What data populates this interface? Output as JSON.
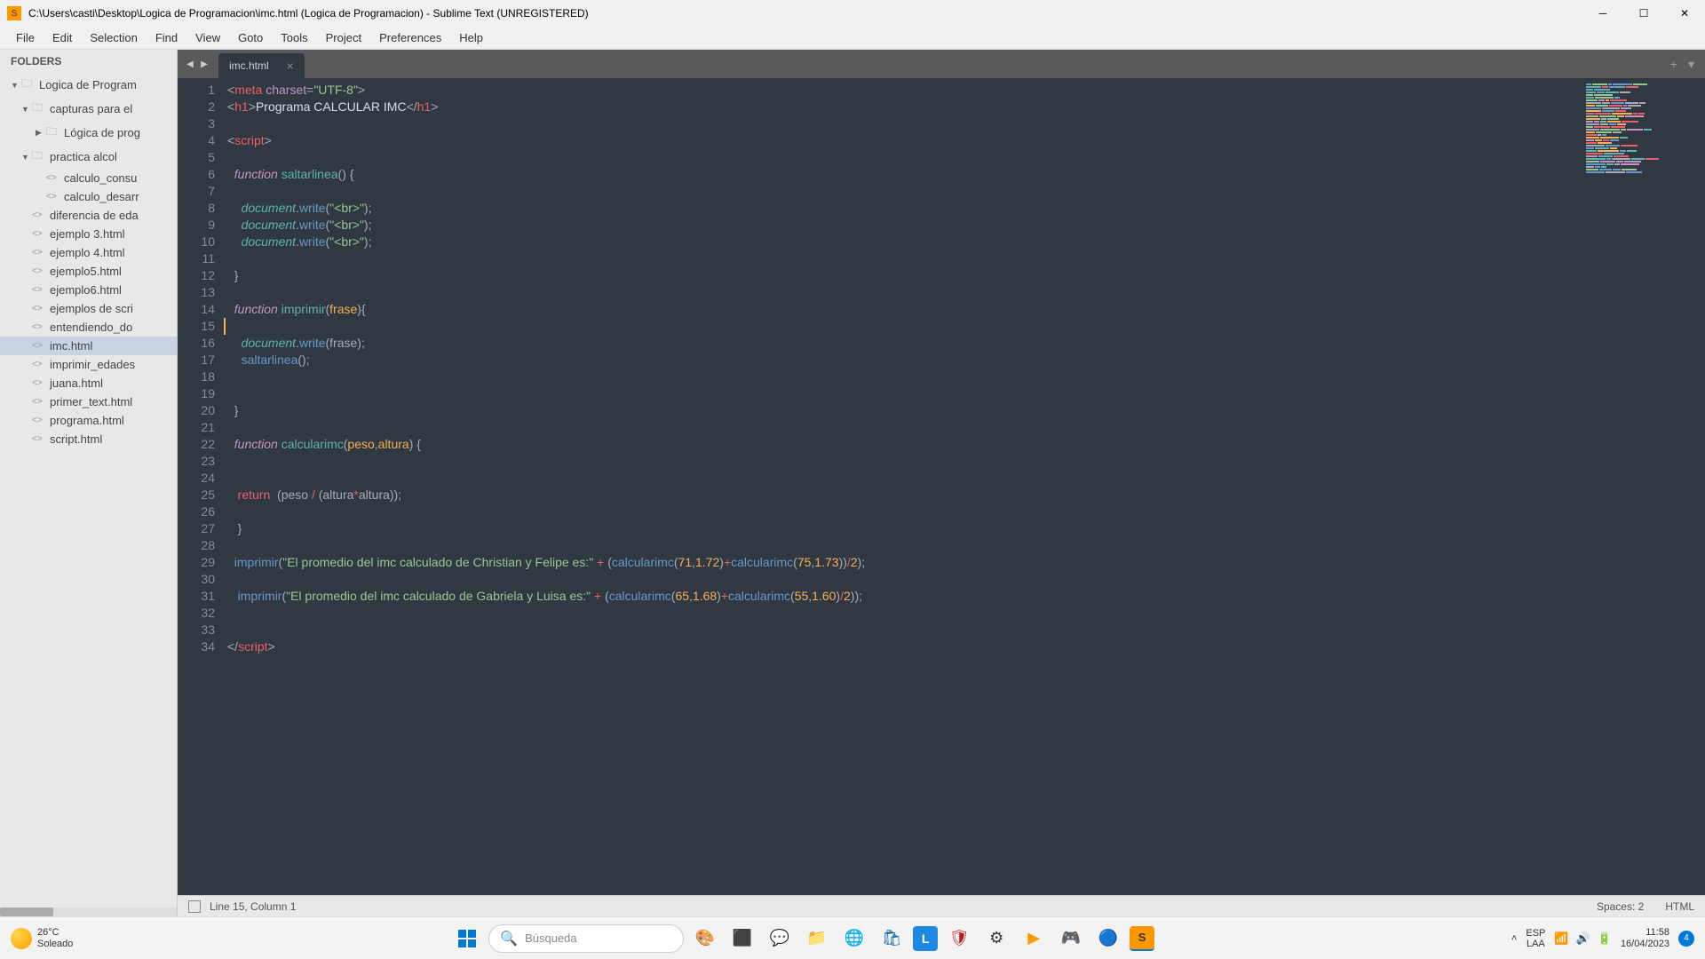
{
  "title": "C:\\Users\\casti\\Desktop\\Logica de Programacion\\imc.html (Logica de Programacion) - Sublime Text (UNREGISTERED)",
  "menu": [
    "File",
    "Edit",
    "Selection",
    "Find",
    "View",
    "Goto",
    "Tools",
    "Project",
    "Preferences",
    "Help"
  ],
  "sidebar": {
    "header": "FOLDERS",
    "tree": [
      {
        "type": "folder",
        "label": "Logica de Program",
        "indent": 0,
        "open": true
      },
      {
        "type": "folder",
        "label": "capturas para el",
        "indent": 1,
        "open": true
      },
      {
        "type": "folder",
        "label": "Lógica de prog",
        "indent": 2,
        "open": false
      },
      {
        "type": "folder",
        "label": "practica alcol",
        "indent": 1,
        "open": true
      },
      {
        "type": "file",
        "label": "calculo_consu",
        "indent": 2
      },
      {
        "type": "file",
        "label": "calculo_desarr",
        "indent": 2
      },
      {
        "type": "file",
        "label": "diferencia de eda",
        "indent": 1
      },
      {
        "type": "file",
        "label": "ejemplo 3.html",
        "indent": 1
      },
      {
        "type": "file",
        "label": "ejemplo 4.html",
        "indent": 1
      },
      {
        "type": "file",
        "label": "ejemplo5.html",
        "indent": 1
      },
      {
        "type": "file",
        "label": "ejemplo6.html",
        "indent": 1
      },
      {
        "type": "file",
        "label": "ejemplos de scri",
        "indent": 1
      },
      {
        "type": "file",
        "label": "entendiendo_do",
        "indent": 1
      },
      {
        "type": "file",
        "label": "imc.html",
        "indent": 1,
        "active": true
      },
      {
        "type": "file",
        "label": "imprimir_edades",
        "indent": 1
      },
      {
        "type": "file",
        "label": "juana.html",
        "indent": 1
      },
      {
        "type": "file",
        "label": "primer_text.html",
        "indent": 1
      },
      {
        "type": "file",
        "label": "programa.html",
        "indent": 1
      },
      {
        "type": "file",
        "label": "script.html",
        "indent": 1
      }
    ]
  },
  "tab": {
    "name": "imc.html"
  },
  "code_lines": 34,
  "status": {
    "pos": "Line 15, Column 1",
    "spaces": "Spaces: 2",
    "lang": "HTML"
  },
  "taskbar": {
    "weather_temp": "26°C",
    "weather_desc": "Soleado",
    "search_placeholder": "Búsqueda",
    "lang1": "ESP",
    "lang2": "LAA",
    "time": "11:58",
    "date": "16/04/2023",
    "notif_count": "4"
  }
}
